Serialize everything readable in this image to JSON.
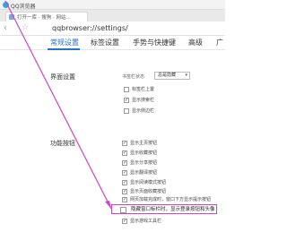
{
  "window": {
    "app_title": "QQ浏览器",
    "logo_icon": "qq-browser-logo-icon"
  },
  "tab": {
    "title": "打开一库 · 搜狗 · 网站..."
  },
  "toolbar": {
    "back_icon": "back-icon",
    "forward_icon": "forward-icon",
    "url": "qqbrowser://settings/",
    "star_icon": "star-icon"
  },
  "settings_tabs": [
    {
      "label": "常规设置"
    },
    {
      "label": "标签设置"
    },
    {
      "label": "手势与快捷键"
    },
    {
      "label": "高级"
    },
    {
      "label": "广"
    }
  ],
  "interface": {
    "title": "界面设置",
    "select_label": "书签栏状态",
    "select_value": "总是隐藏",
    "options": [
      {
        "label": "标签栏上置",
        "checked": false
      },
      {
        "label": "显示搜索栏",
        "checked": true
      },
      {
        "label": "显示侧边栏",
        "checked": false
      }
    ]
  },
  "functions": {
    "title": "功能按钮",
    "options": [
      {
        "label": "显示主页按钮",
        "checked": true
      },
      {
        "label": "显示收藏按钮",
        "checked": true
      },
      {
        "label": "显示分享按钮",
        "checked": true
      },
      {
        "label": "显示翻译按钮",
        "checked": true
      },
      {
        "label": "显示阅读模式按钮",
        "checked": true
      },
      {
        "label": "显示页面收藏按钮",
        "checked": true
      },
      {
        "label": "网页加载完成时，窗口下方显示提示按钮",
        "checked": true
      }
    ],
    "highlighted_option": {
      "label": "隐藏窗口标栏时，显示登录按钮和头像",
      "checked": false
    },
    "last_option": {
      "label": "显示游戏工具栏",
      "checked": true
    }
  },
  "colors": {
    "accent": "#2b6fc9",
    "annotation": "#cc44cc"
  }
}
